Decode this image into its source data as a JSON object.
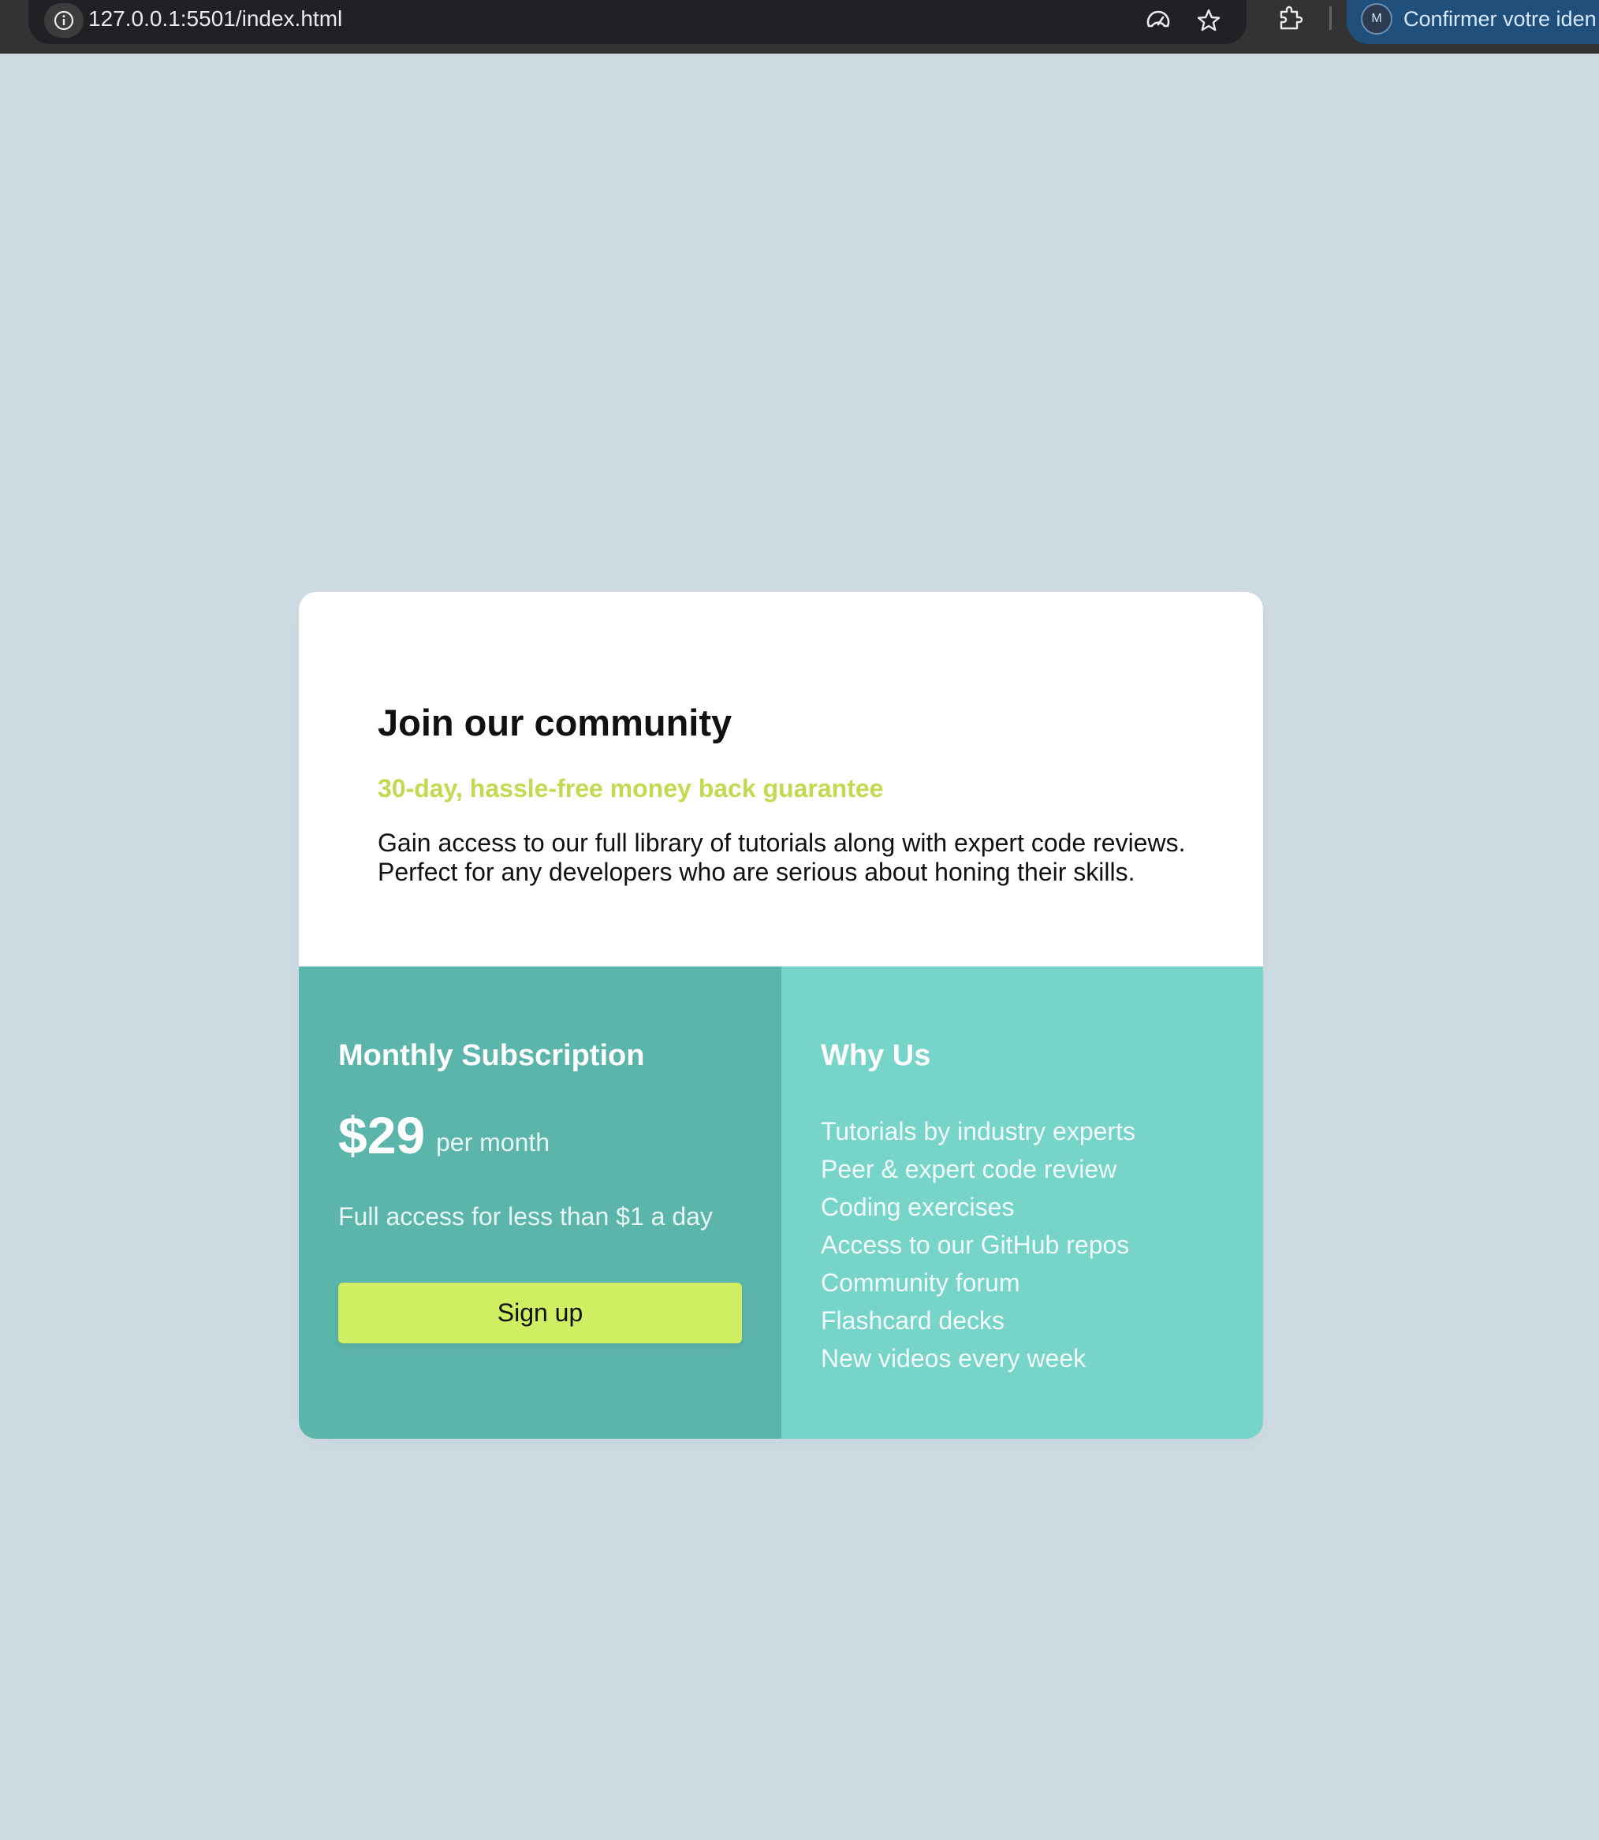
{
  "browser": {
    "url": "127.0.0.1:5501/index.html",
    "profile_initial": "M",
    "profile_label": "Confirmer votre iden",
    "icons": [
      "info-icon",
      "performance-icon",
      "star-icon",
      "extensions-icon"
    ]
  },
  "card": {
    "title": "Join our community",
    "guarantee": "30-day, hassle-free money back guarantee",
    "description": "Gain access to our full library of tutorials along with expert code reviews. Perfect for any developers who are serious about honing their skills."
  },
  "subscription": {
    "title": "Monthly Subscription",
    "price": "$29",
    "period": "per month",
    "access_text": "Full access for less than $1 a day",
    "button_label": "Sign up"
  },
  "why_us": {
    "title": "Why Us",
    "items": [
      "Tutorials by industry experts",
      "Peer & expert code review",
      "Coding exercises",
      "Access to our GitHub repos",
      "Community forum",
      "Flashcard decks",
      "New videos every week"
    ]
  },
  "colors": {
    "page_background": "#cfdbe2",
    "accent_lime": "#c4d94f",
    "button_lime": "#d0ee62",
    "teal_dark": "#5cb5aa",
    "teal_light": "#77d4c8"
  }
}
